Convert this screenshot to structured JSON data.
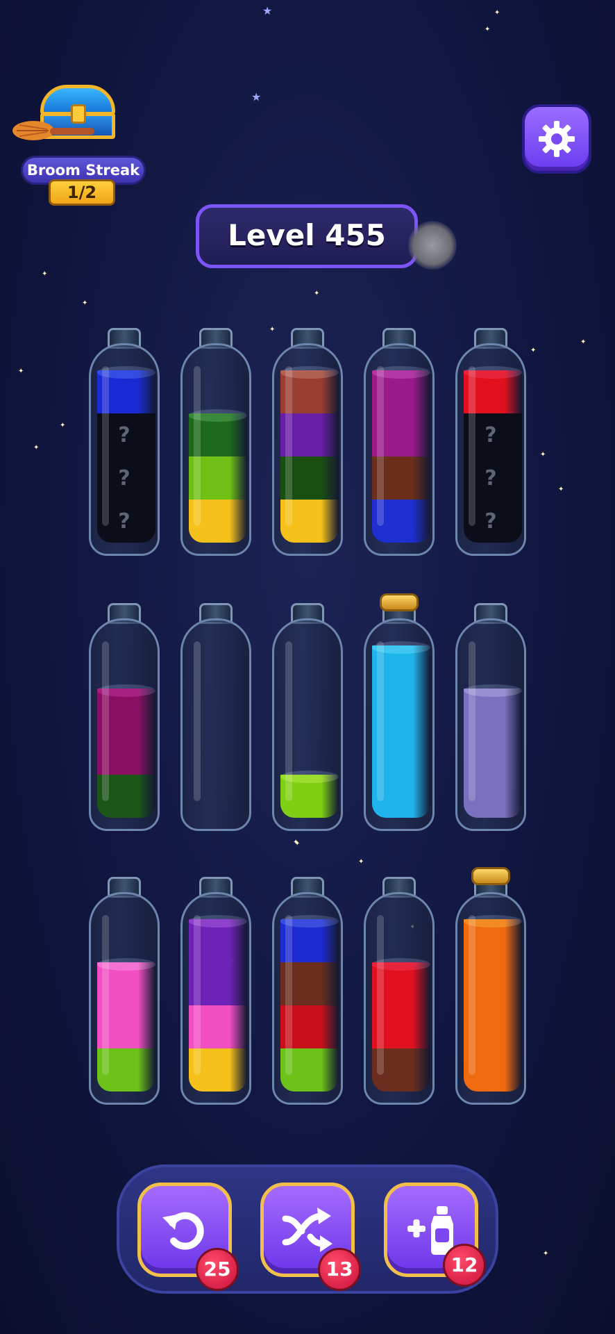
{
  "streak": {
    "label": "Broom Streak",
    "count": "1/2"
  },
  "level": {
    "label": "Level 455"
  },
  "tools": [
    {
      "name": "undo",
      "icon": "undo-icon",
      "count": "25"
    },
    {
      "name": "shuffle",
      "icon": "shuffle-icon",
      "count": "13"
    },
    {
      "name": "add-bottle",
      "icon": "add-bottle-icon",
      "count": "12"
    }
  ],
  "bottles": [
    {
      "row": 1,
      "layers_top_to_bottom": [
        "#1a2bd6",
        "hidden",
        "hidden",
        "hidden"
      ],
      "hidden_mark": "?"
    },
    {
      "row": 1,
      "layers_top_to_bottom": [
        "#1d6a1c",
        "#6fc215",
        "#f5c11a"
      ]
    },
    {
      "row": 1,
      "layers_top_to_bottom": [
        "#9b3e32",
        "#6a1ea8",
        "#1a4f12",
        "#f5c11a"
      ]
    },
    {
      "row": 1,
      "layers_top_to_bottom": [
        "#9a1a88",
        "#9a1a88",
        "#6b2e1a",
        "#1e2ed0"
      ]
    },
    {
      "row": 1,
      "layers_top_to_bottom": [
        "#e0101e",
        "hidden",
        "hidden",
        "hidden"
      ],
      "hidden_mark": "?"
    },
    {
      "row": 2,
      "layers_top_to_bottom": [
        "#8a0f62",
        "#8a0f62",
        "#1b5618"
      ]
    },
    {
      "row": 2,
      "layers_top_to_bottom": []
    },
    {
      "row": 2,
      "layers_top_to_bottom": [
        "#7fd014"
      ]
    },
    {
      "row": 2,
      "layers_top_to_bottom": [
        "#20b4ec",
        "#20b4ec",
        "#20b4ec",
        "#20b4ec"
      ],
      "corked": true
    },
    {
      "row": 2,
      "layers_top_to_bottom": [
        "#7a70c0",
        "#7a70c0",
        "#7a70c0"
      ]
    },
    {
      "row": 3,
      "layers_top_to_bottom": [
        "#f24fc2",
        "#f24fc2",
        "#6cc218"
      ]
    },
    {
      "row": 3,
      "layers_top_to_bottom": [
        "#6e22b8",
        "#6e22b8",
        "#f24fc2",
        "#f5c11a"
      ]
    },
    {
      "row": 3,
      "layers_top_to_bottom": [
        "#1d2bd2",
        "#6b2e1e",
        "#c9101a",
        "#6cc218"
      ]
    },
    {
      "row": 3,
      "layers_top_to_bottom": [
        "#e0101e",
        "#e0101e",
        "#6b2e1e"
      ]
    },
    {
      "row": 3,
      "layers_top_to_bottom": [
        "#f06a10",
        "#f06a10",
        "#f06a10",
        "#f06a10"
      ],
      "corked": true
    }
  ]
}
